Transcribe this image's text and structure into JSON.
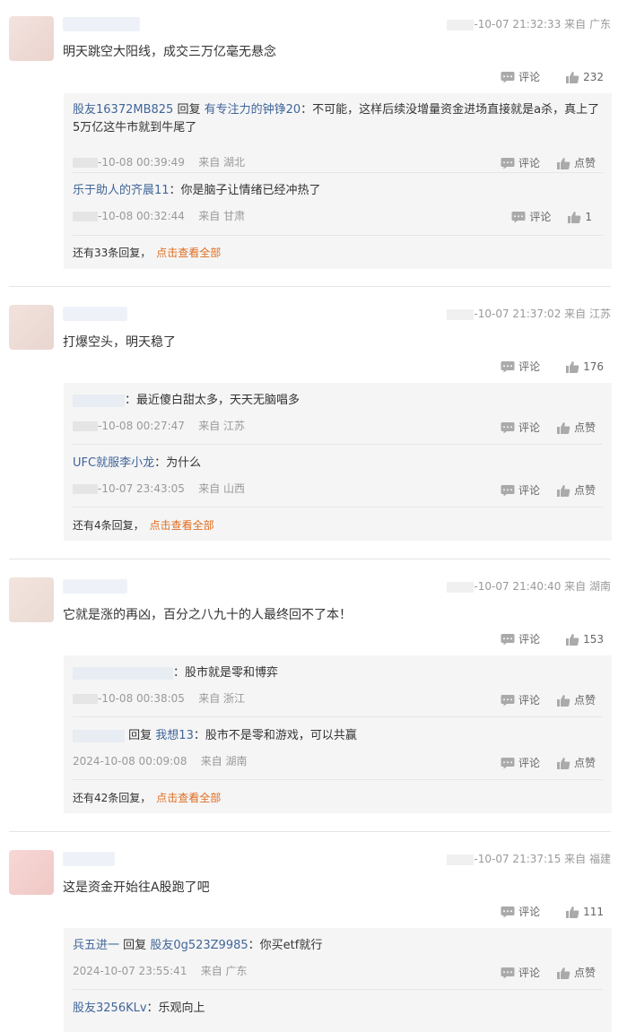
{
  "labels": {
    "comment": "评论",
    "like": "点赞",
    "reply_word": "回复",
    "from": "来自"
  },
  "comments": [
    {
      "time": "-10-07 21:32:33",
      "location": "来自 广东",
      "text": "明天跳空大阳线，成交三万亿毫无悬念",
      "likes": "232",
      "reply1": {
        "user": "股友16372MB825",
        "reply_word": "回复",
        "target": "有专注力的钟铮20",
        "text": "：不可能，这样后续没增量资金进场直接就是a杀，真上了5万亿这牛市就到牛尾了",
        "time": "-10-08 00:39:49",
        "location": "来自 湖北",
        "like": "点赞"
      },
      "reply2": {
        "user": "乐于助人的齐晨11",
        "text": "：你是脑子让情绪已经冲热了",
        "time": "-10-08 00:32:44",
        "location": "来自 甘肃",
        "like": "1"
      },
      "more": "还有33条回复，",
      "more_link": "点击查看全部"
    },
    {
      "time": "-10-07 21:37:02",
      "location": "来自 江苏",
      "text": "打爆空头，明天稳了",
      "likes": "176",
      "reply1": {
        "text": "：最近傻白甜太多，天天无脑唱多",
        "time": "-10-08 00:27:47",
        "location": "来自 江苏",
        "like": "点赞"
      },
      "reply2": {
        "user": "UFC就服李小龙",
        "text": "：为什么",
        "time": "-10-07 23:43:05",
        "location": "来自 山西",
        "like": "点赞"
      },
      "more": "还有4条回复，",
      "more_link": "点击查看全部"
    },
    {
      "time": "-10-07 21:40:40",
      "location": "来自 湖南",
      "text": "它就是涨的再凶，百分之八九十的人最终回不了本！",
      "likes": "153",
      "reply1": {
        "text": "：股市就是零和博弈",
        "time": "-10-08 00:38:05",
        "location": "来自 浙江",
        "like": "点赞"
      },
      "reply2": {
        "reply_word": "回复",
        "target": "我想13",
        "text": "：股市不是零和游戏，可以共赢",
        "time": "2024-10-08 00:09:08",
        "location": "来自 湖南",
        "like": "点赞"
      },
      "more": "还有42条回复，",
      "more_link": "点击查看全部"
    },
    {
      "time": "-10-07 21:37:15",
      "location": "来自 福建",
      "text": "这是资金开始往A股跑了吧",
      "likes": "111",
      "reply1": {
        "user": "兵五进一",
        "reply_word": "回复",
        "target": "股友0g523Z9985",
        "text": "：你买etf就行",
        "time": "2024-10-07 23:55:41",
        "location": "来自 广东",
        "like": "点赞"
      },
      "reply2": {
        "user": "股友3256KLv",
        "text": "：乐观向上"
      }
    }
  ],
  "colors": {
    "link": "#406599",
    "more_link": "#e06d1f",
    "reply_bg": "#f5f5f5"
  },
  "icons": {
    "comment": "speech-bubble-icon",
    "like": "thumbs-up-icon"
  }
}
